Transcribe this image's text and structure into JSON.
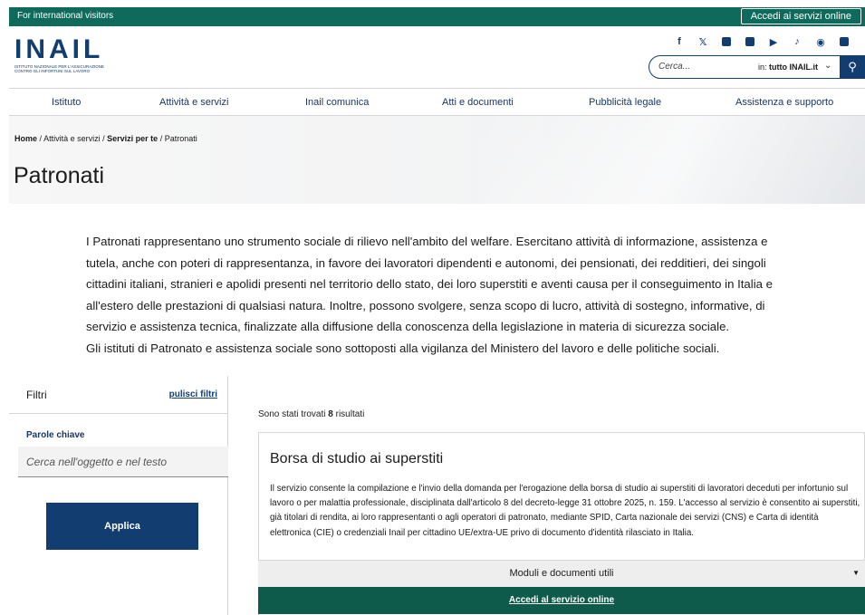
{
  "topbar": {
    "intl_link": "For international visitors",
    "login_button": "Accedi ai servizi online"
  },
  "logo": {
    "word": "INAIL",
    "subtitle": "ISTITUTO NAZIONALE PER L'ASSICURAZIONE CONTRO GLI INFORTUNI SUL LAVORO"
  },
  "social": [
    "facebook-icon",
    "x-icon",
    "instagram-icon",
    "linkedin-icon",
    "youtube-icon",
    "tiktok-icon",
    "podcast-icon",
    "rss-icon"
  ],
  "search": {
    "placeholder": "Cerca...",
    "scope_prefix": "in:",
    "scope_value": "tutto INAIL.it"
  },
  "nav": {
    "items": [
      "Istituto",
      "Attività e servizi",
      "Inail comunica",
      "Atti e documenti",
      "Pubblicità legale",
      "Assistenza e supporto"
    ]
  },
  "breadcrumb": {
    "home": "Home",
    "level1": "Attività e servizi",
    "level2": "Servizi per te",
    "current": "Patronati",
    "separator": "/"
  },
  "page_title": "Patronati",
  "intro": {
    "paragraph1": "I Patronati rappresentano uno strumento sociale di rilievo nell'ambito del welfare. Esercitano attività di informazione, assistenza e tutela, anche con poteri di rappresentanza, in favore dei lavoratori dipendenti e autonomi, dei pensionati, dei redditieri, dei singoli cittadini italiani, stranieri e apolidi presenti nel territorio dello stato, dei loro superstiti e aventi causa per il conseguimento in Italia e all'estero delle prestazioni di qualsiasi natura. Inoltre, possono svolgere, senza scopo di lucro, attività di sostegno, informative, di servizio e assistenza tecnica, finalizzate alla diffusione della conoscenza della legislazione in materia di sicurezza sociale.",
    "paragraph2": "Gli istituti di Patronato e assistenza sociale sono sottoposti alla vigilanza del Ministero del lavoro e delle politiche sociali."
  },
  "filters": {
    "title": "Filtri",
    "clear_link": "pulisci filtri",
    "keywords_label": "Parole chiave",
    "keywords_placeholder": "Cerca nell'oggetto e nel testo",
    "apply_button": "Applica"
  },
  "results": {
    "prefix": "Sono stati trovati",
    "count": "8",
    "suffix": "risultati"
  },
  "card": {
    "title": "Borsa di studio ai superstiti",
    "description": "Il servizio consente la compilazione e l'invio della domanda per l'erogazione della borsa di studio ai superstiti di lavoratori deceduti per infortunio sul lavoro o per malattia professionale, disciplinata dall'articolo 8 del decreto-legge 31 ottobre 2025, n. 159. L'accesso al servizio è consentito ai superstiti, già titolari di rendita, ai loro rappresentanti o agli operatori di patronato, mediante SPID, Carta nazionale dei servizi (CNS) e Carta di identità elettronica (CIE) o credenziali Inail per cittadino UE/extra-UE privo di documento d'identità rilasciato in Italia.",
    "accordion_label": "Moduli e documenti utili",
    "online_link": "Accedi al servizio online"
  },
  "colors": {
    "brand_green": "#0e6a5a",
    "brand_blue": "#123d70"
  }
}
